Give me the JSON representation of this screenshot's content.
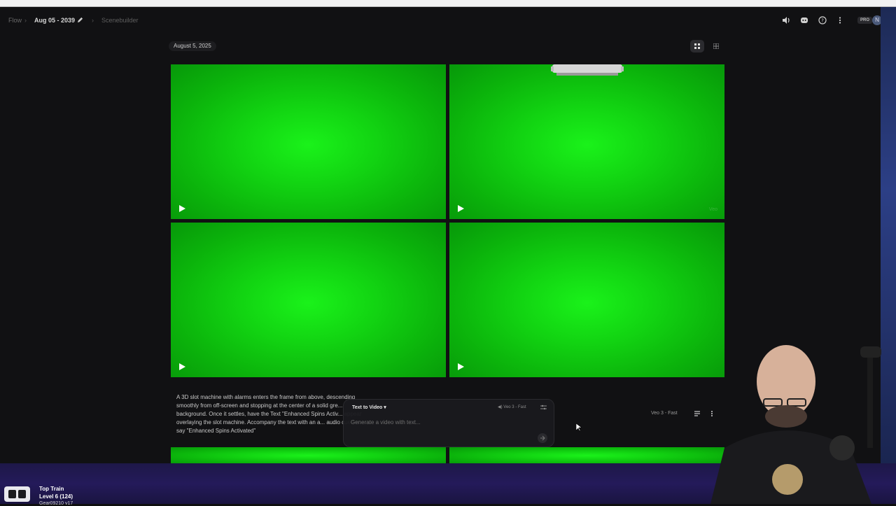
{
  "breadcrumb": {
    "root": "Flow",
    "project": "Aug 05 - 2039",
    "scene": "Scenebuilder"
  },
  "header": {
    "pro_badge": "PRO",
    "avatar_initial": "N"
  },
  "date_chip": "August 5, 2025",
  "tiles": [
    {
      "watermark": ""
    },
    {
      "watermark": "Veo"
    },
    {
      "watermark": ""
    },
    {
      "watermark": ""
    }
  ],
  "prompt": {
    "text": "A 3D slot machine with alarms enters the frame from above, descending smoothly from off-screen and stopping at the center of a solid gre... background. Once it settles, have the Text \"Enhanced Spins Activ... appear overlaying the slot machine. Accompany the text with an a... audio cue to say \"Enhanced Spins Activated\""
  },
  "composer": {
    "mode_label": "Text to Video",
    "model_label": "Veo 3 - Fast",
    "placeholder": "Generate a video with text..."
  },
  "row_model": "Veo 3 - Fast",
  "taskbar": {
    "title": "Top Train",
    "level": "Level 6  (124)",
    "sub": "Gear09210 v17"
  },
  "colors": {
    "green_screen": "#16e016",
    "background": "#111113"
  }
}
